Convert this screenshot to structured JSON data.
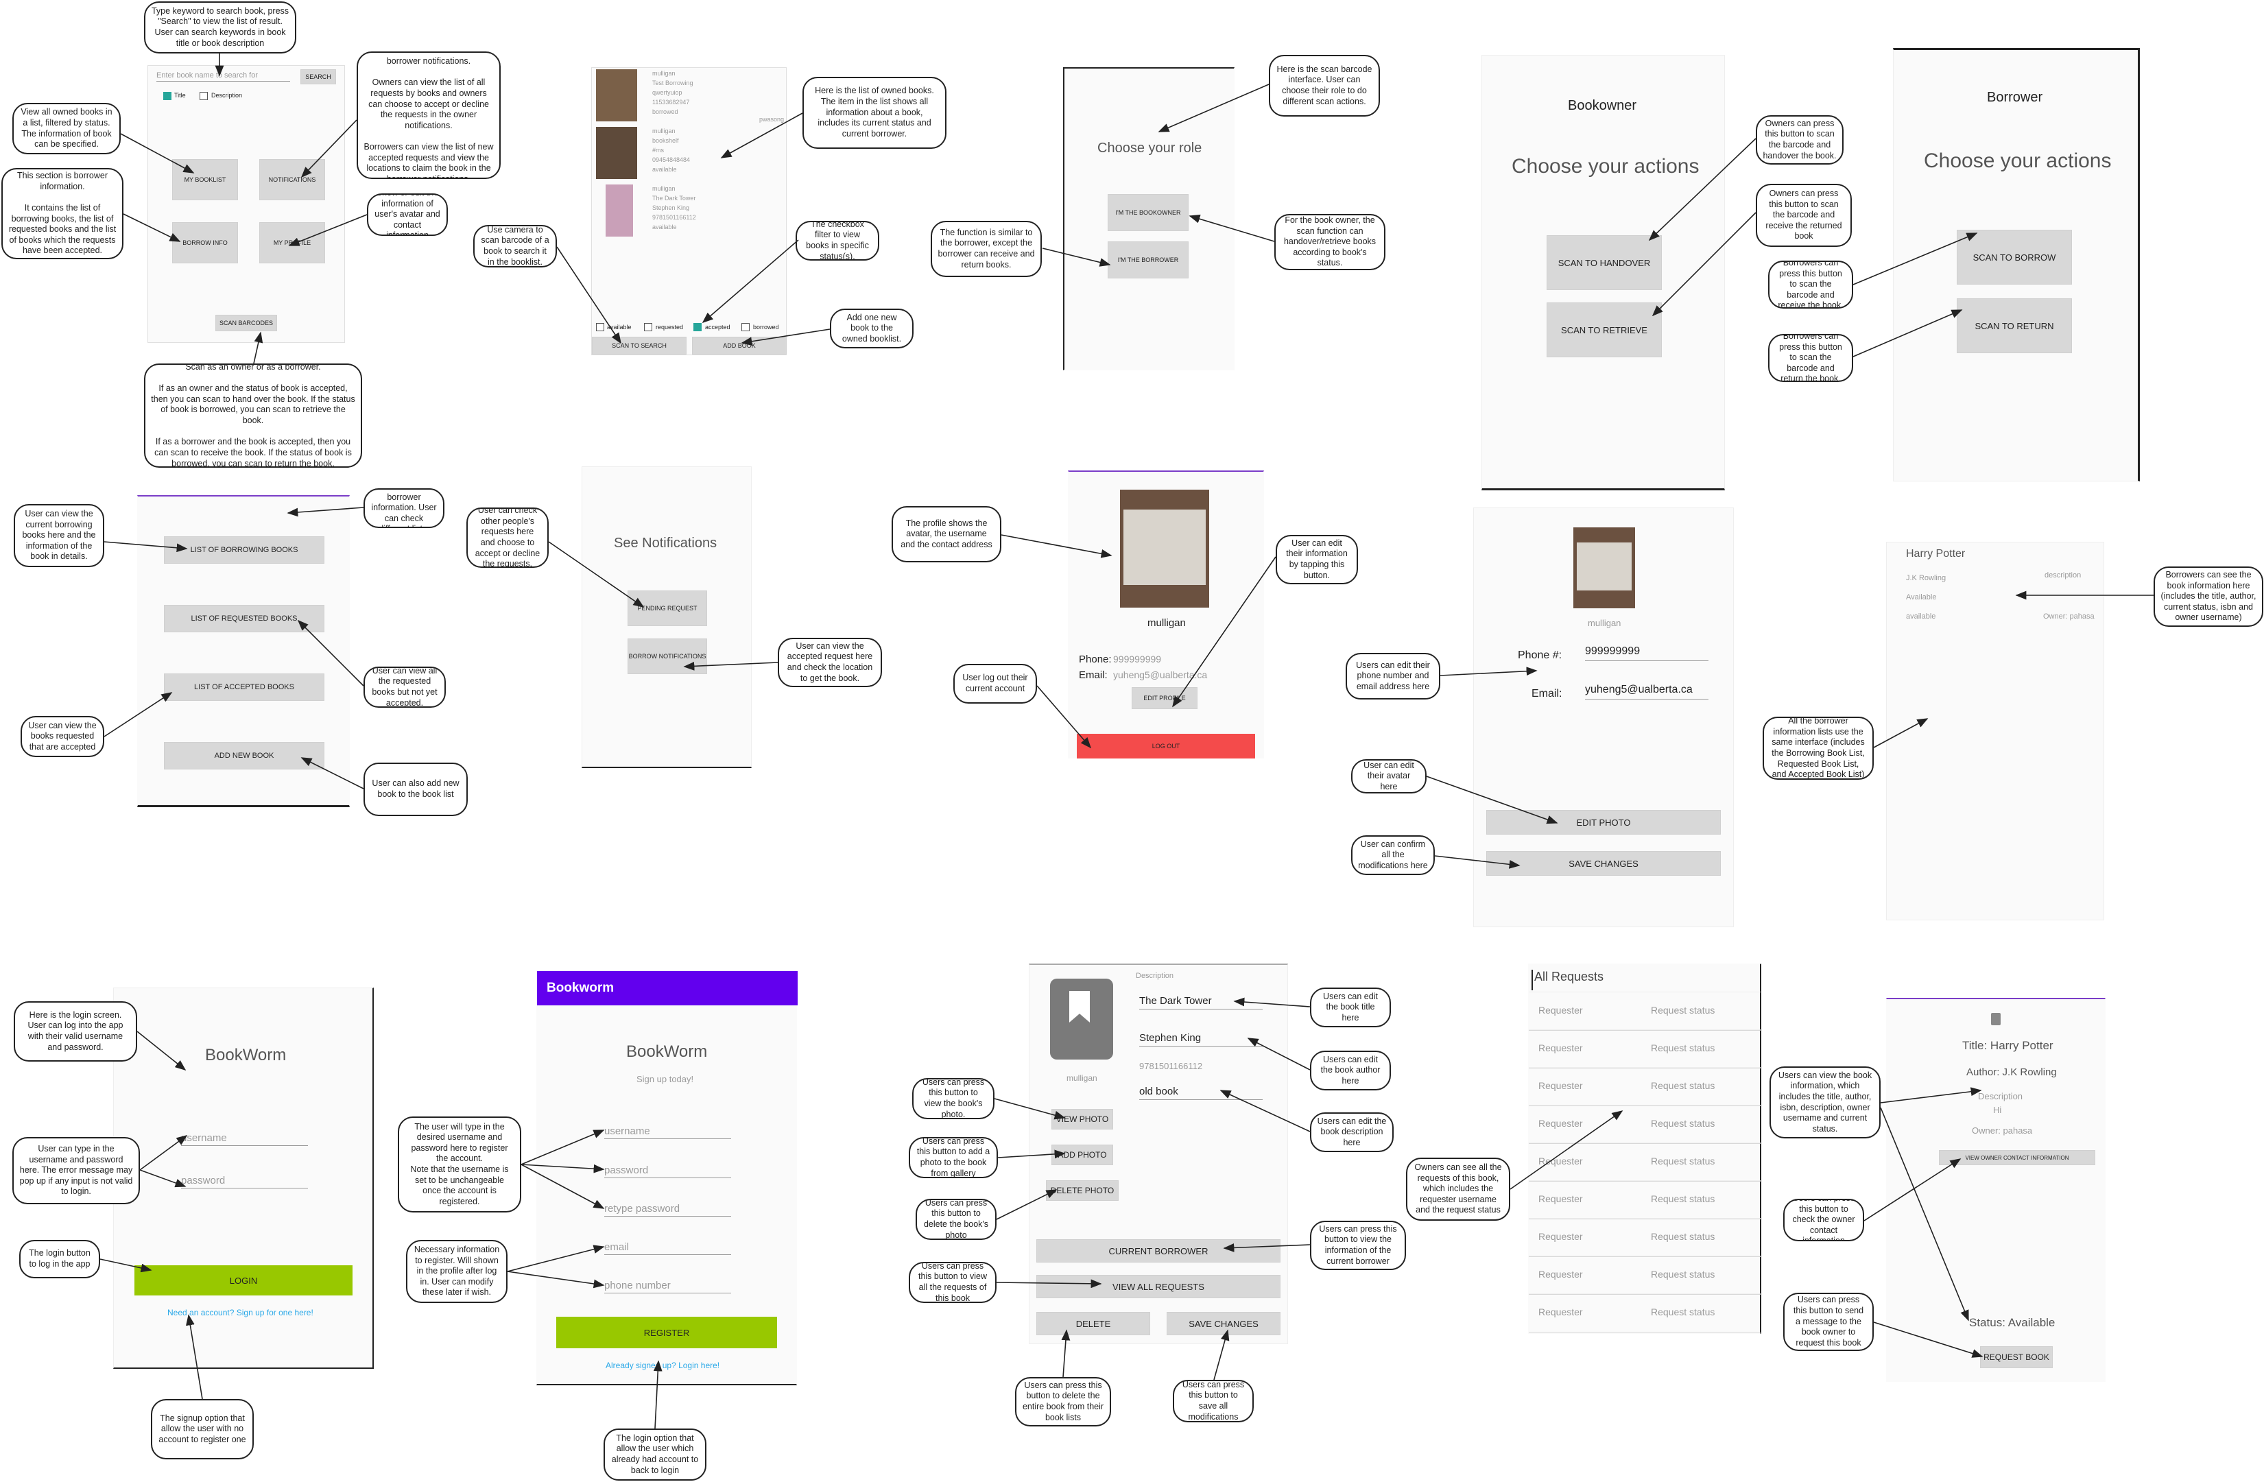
{
  "notes": {
    "search": "Type keyword to search book, press \"Search\" to view the list of result. User can search keywords in book title or book description",
    "notifications": "It contains owner notifications and borrower notifications.\n\nOwners can view the list of all requests by books and owners can choose to accept or decline the requests in the owner notifications.\n\nBorrowers can view the list of new accepted requests and view the locations to claim the book in the borrower notifications.",
    "booklist": "View all owned books in a list, filtered by status. The information of book can be specified.",
    "borrow_info": "This section is borrower information.\n\nIt contains the list of borrowing books, the list of requested books and the list of books which the requests have been accepted.",
    "profile": "Show or edit the information of user's avatar and contact information",
    "scan": "Scan as an owner or as a borrower.\n\nIf as an owner and the status of book is accepted, then you can scan to hand over the book. If the status of book is borrowed, you can scan to retrieve the book.\n\nIf as a borrower and the book is accepted, then you can scan to receive the book. If the status of book is borrowed, you can scan to return the book.",
    "owned_list": "Here is the list of owned books. The item in the list shows all information about a book, includes its current status and current borrower.",
    "camera": "Use camera to scan barcode of a book to search it in the booklist.",
    "checkbox": "The checkbox filter to view books in specific status(s).",
    "add_book": "Add one new book to the owned booklist.",
    "scan_iface": "Here is the scan barcode interface. User can choose their role to do different scan actions.",
    "borrower_similar": "The function is similar to the borrower, except the borrower can receive and return books.",
    "owner_scan": "For the book owner, the scan function can handover/retrieve books according to book's status.",
    "handover": "Owners can press this button to scan the barcode and handover the book.",
    "retrieve": "Owners can press this button to scan the barcode and receive the returned book",
    "borrow": "Borrowers can press this button to scan the barcode and receive the book.",
    "return": "Borrowers can press this button to scan the barcode and return the book.",
    "borrower_info": "Here is the borrower information. User can check different lists.",
    "borrowing_books": "User can view the current borrowing books here and the information of the book in details.",
    "requested": "User can view all the requested books but not yet accepted.",
    "accepted": "User can view the books requested that are accepted",
    "add_new": "User can also add new book to the book list",
    "check_requests": "User can check other people's requests here and choose to accept or decline the requests.",
    "accepted_req": "User can view the accepted request here and check the location to get the book.",
    "profile_avatar": "The profile shows the avatar, the username and the contact address",
    "edit_info": "User can edit their information by tapping this button.",
    "logout": "User log out their current account",
    "edit_phone": "Users can edit their phone number and email address here",
    "edit_avatar": "User can edit their avatar here",
    "confirm": "User can confirm all the modifications here",
    "borrowers_see": "Borrowers can see the book information here (includes the title, author, current status, isbn and owner username)",
    "same_iface": "All the borrower information lists use the same interface (includes the Borrowing Book List, Requested Book List, and Accepted Book List)",
    "login_screen": "Here is the login screen. User can log into the app with their valid username and password.",
    "type_user": "User can type in the username and password here. The error message may pop up if any input is not valid to login.",
    "login_btn": "The login button to log in the app",
    "signup_opt": "The signup option that allow the user with no account to register one",
    "register": "The user will type in the desired username and password here to register the account.\nNote that the username is set to be unchangeable once the account is registered.",
    "necessary": "Necessary information to register. Will shown in the profile after log in. User can modify these later if wish.",
    "login_opt": "The login option that allow the user which already had account to back to login",
    "edit_title": "Users can edit the book title here",
    "edit_author": "Users can edit the book author here",
    "edit_desc": "Users can edit the book description here",
    "view_photo": "Users can press this button to view the book's photo.",
    "add_photo": "Users can press this button to add a photo to the book from gallery",
    "delete_photo": "Users can press this button to delete the book's photo",
    "view_all": "Users can press this button to view all the requests of this book",
    "current_borrower": "Users can press this button to view the information of the current borrower",
    "delete_book": "Users can press this button to delete the entire book from their book lists",
    "save_mod": "Users can press this button to save all modifications",
    "owners_all_req": "Owners can see all the requests of this book, which includes the requester username and the request status",
    "book_info": "Users can view the book information, which includes the title, author, isbn, description, owner username and current status.",
    "owner_contact": "Users can press this button to check the owner contact information",
    "send_request": "Users can press this button to send a message to the book owner to request this book"
  },
  "home": {
    "search_placeholder": "Enter book name to search for",
    "search_btn": "SEARCH",
    "title_cb": "Title",
    "desc_cb": "Description",
    "my_booklist": "MY BOOKLIST",
    "notifications": "NOTIFICATIONS",
    "borrow_info": "BORROW INFO",
    "my_profile": "MY PROFILE",
    "scan_barcodes": "SCAN BARCODES"
  },
  "owned": {
    "items": [
      {
        "lines": [
          "mulligan",
          "Test Borrowing",
          "qwertyuiop",
          "11533682947",
          "borrowed"
        ],
        "side": "pwasong"
      },
      {
        "lines": [
          "mulligan",
          "bookshelf",
          "#ms",
          "09454848484",
          "available"
        ],
        "side": ""
      },
      {
        "lines": [
          "mulligan",
          "The Dark Tower",
          "Stephen King",
          "9781501166112",
          "available"
        ],
        "side": ""
      }
    ],
    "filters": [
      "available",
      "requested",
      "accepted",
      "borrowed"
    ],
    "scan_search": "SCAN TO SEARCH",
    "add_book": "ADD BOOK"
  },
  "role": {
    "title": "Choose your role",
    "owner_btn": "I'M THE BOOKOWNER",
    "borrower_btn": "I'M THE BORROWER"
  },
  "bookowner": {
    "header": "Bookowner",
    "title": "Choose your actions",
    "handover": "SCAN TO HANDOVER",
    "retrieve": "SCAN TO RETRIEVE"
  },
  "borrower": {
    "header": "Borrower",
    "title": "Choose your actions",
    "borrow": "SCAN TO BORROW",
    "return": "SCAN TO RETURN"
  },
  "borrow_lists": {
    "borrowing": "LIST OF BORROWING BOOKS",
    "requested": "LIST OF REQUESTED BOOKS",
    "accepted": "LIST OF ACCEPTED BOOKS",
    "add_new": "ADD NEW BOOK"
  },
  "notif_screen": {
    "title": "See Notifications",
    "pending": "PENDING REQUEST",
    "borrow_notif": "BORROW NOTIFICATIONS"
  },
  "profile_view": {
    "username": "mulligan",
    "phone_label": "Phone:",
    "phone": "999999999",
    "email_label": "Email:",
    "email": "yuheng5@ualberta.ca",
    "edit": "EDIT PROFILE",
    "logout": "LOG OUT"
  },
  "profile_edit": {
    "username": "mulligan",
    "phone_label": "Phone #:",
    "phone": "999999999",
    "email_label": "Email:",
    "email": "yuheng5@ualberta.ca",
    "edit_photo": "EDIT PHOTO",
    "save": "SAVE CHANGES"
  },
  "book_list_item": {
    "title": "Harry Potter",
    "author": "J.K Rowling",
    "status": "Available",
    "status2": "available",
    "desc": "description",
    "owner": "Owner: pahasa"
  },
  "login": {
    "app": "BookWorm",
    "username": "username",
    "password": "password",
    "login": "LOGIN",
    "signup": "Need an account? Sign up for one here!"
  },
  "signup": {
    "bar": "Bookworm",
    "app": "BookWorm",
    "sub": "Sign up today!",
    "username": "username",
    "password": "password",
    "retype": "retype password",
    "email": "email",
    "phone": "phone number",
    "register": "REGISTER",
    "login_link": "Already signed up? Login here!"
  },
  "edit_book": {
    "desc_label": "Description",
    "title": "The Dark Tower",
    "author": "Stephen King",
    "isbn": "9781501166112",
    "desc": "old book",
    "owner": "mulligan",
    "view_photo": "VIEW PHOTO",
    "add_photo": "ADD PHOTO",
    "delete_photo": "DELETE PHOTO",
    "current_borrower": "CURRENT BORROWER",
    "view_all": "VIEW ALL REQUESTS",
    "delete": "DELETE",
    "save": "SAVE CHANGES"
  },
  "all_requests": {
    "title": "All Requests",
    "rows": [
      [
        "Requester",
        "Request status"
      ],
      [
        "Requester",
        "Request status"
      ],
      [
        "Requester",
        "Request status"
      ],
      [
        "Requester",
        "Request status"
      ],
      [
        "Requester",
        "Request status"
      ],
      [
        "Requester",
        "Request status"
      ],
      [
        "Requester",
        "Request status"
      ],
      [
        "Requester",
        "Request status"
      ],
      [
        "Requester",
        "Request status"
      ]
    ]
  },
  "book_detail": {
    "title": "Title: Harry Potter",
    "author": "Author: J.K Rowling",
    "desc_label": "Description",
    "desc": "Hi",
    "owner": "Owner: pahasa",
    "contact": "VIEW OWNER CONTACT INFORMATION",
    "status": "Status: Available",
    "request": "REQUEST BOOK"
  }
}
